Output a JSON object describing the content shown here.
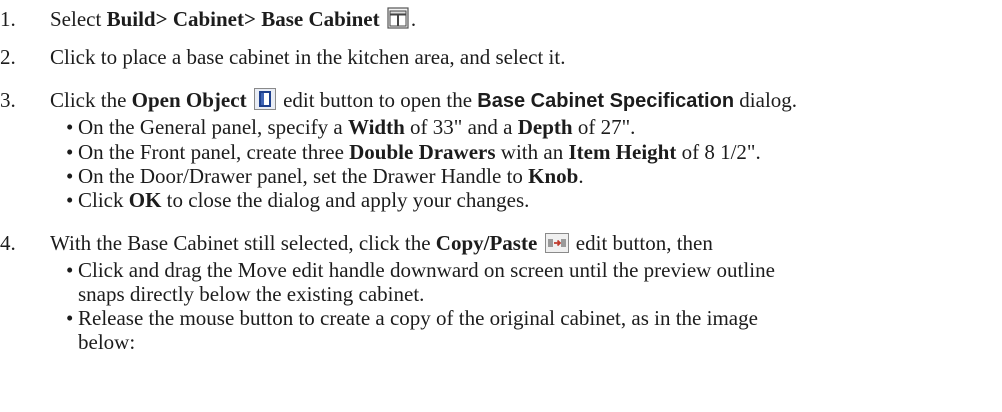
{
  "steps": [
    {
      "number": "1.",
      "prefix": "Select ",
      "menu_path": "Build> Cabinet> Base Cabinet",
      "icon": "base-cabinet-icon",
      "suffix": "."
    },
    {
      "number": "2.",
      "text": "Click to place a base cabinet in the kitchen area, and select it."
    },
    {
      "number": "3.",
      "prefix": "Click the ",
      "button_name": "Open Object",
      "icon": "open-object-icon",
      "middle": " edit button to open the ",
      "dialog_name": "Base Cabinet Specification",
      "suffix": " dialog.",
      "bullets": [
        {
          "a": "On the General panel, specify a ",
          "b1": "Width",
          "c": " of 33\" and a ",
          "b2": "Depth",
          "d": " of 27\"."
        },
        {
          "a": "On the Front panel, create three ",
          "b1": "Double Drawers",
          "c": " with an ",
          "b2": "Item Height",
          "d": " of 8 1/2\"."
        },
        {
          "a": "On the Door/Drawer panel, set the Drawer Handle to ",
          "b1": "Knob",
          "c": "."
        },
        {
          "a": "Click ",
          "b1": "OK",
          "c": " to close the dialog and apply your changes."
        }
      ]
    },
    {
      "number": "4.",
      "prefix": "With the Base Cabinet still selected, click the ",
      "button_name": "Copy/Paste",
      "icon": "copy-paste-icon",
      "suffix": " edit button, then",
      "bullets": [
        {
          "line1": "Click and drag the Move edit handle downward on screen until the preview outline",
          "line2": "snaps directly below the existing cabinet."
        },
        {
          "line1": "Release the mouse button to create a copy of the original cabinet, as in the image",
          "line2": "below:"
        }
      ]
    }
  ],
  "colors": {
    "text": "#1c1c1c",
    "icon_blue": "#1d3f8c",
    "icon_gray": "#9a9a9a",
    "icon_red": "#c0392b"
  }
}
